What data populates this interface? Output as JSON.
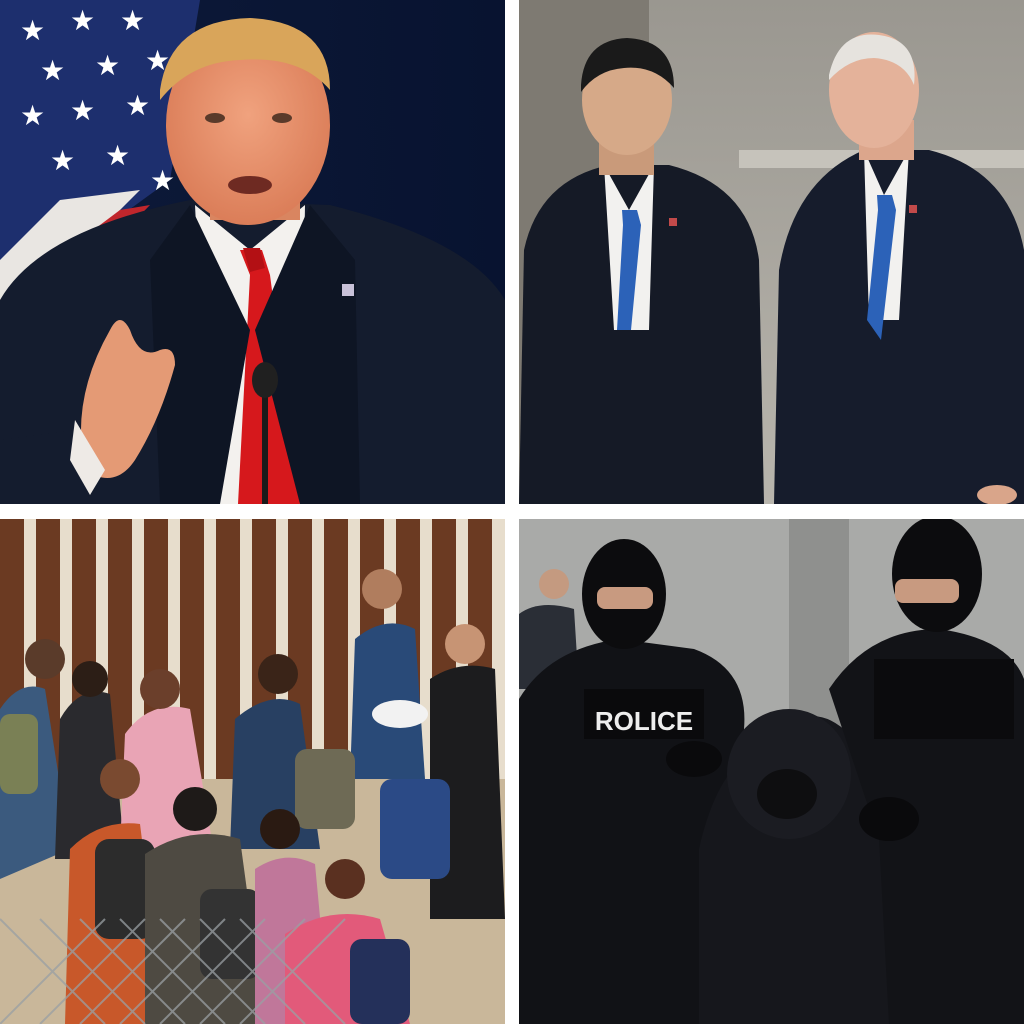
{
  "panels": [
    {
      "subject": "speaker-at-podium"
    },
    {
      "subject": "two-officials-walking"
    },
    {
      "subject": "migrants-at-border-fence"
    },
    {
      "subject": "police-arrest"
    }
  ],
  "vest_label": "ROLICE",
  "colors": {
    "suit": "#141c2e",
    "red_tie": "#d6181c",
    "blue_tie": "#2c62b8",
    "border_fence": "#6b3a22",
    "police_black": "#111216"
  }
}
